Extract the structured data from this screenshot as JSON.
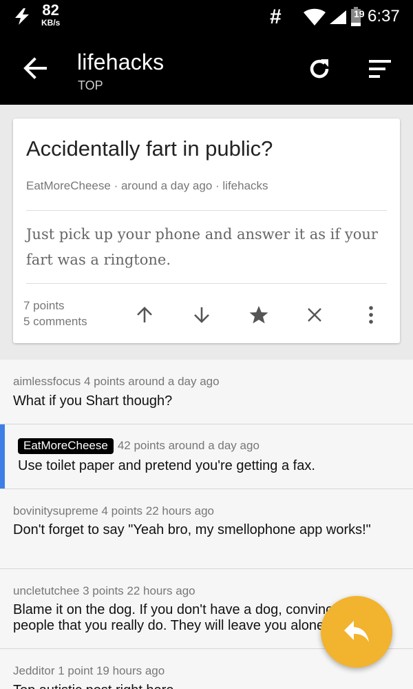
{
  "status_bar": {
    "speed_value": "82",
    "speed_unit": "KB/s",
    "hash": "#",
    "battery_level": "19",
    "time": "6:37"
  },
  "app_bar": {
    "title": "lifehacks",
    "subtitle": "TOP",
    "icons": [
      "back-arrow-icon",
      "refresh-icon",
      "sort-icon"
    ]
  },
  "post": {
    "title": "Accidentally fart in public?",
    "author": "EatMoreCheese",
    "time": "around a day ago",
    "subreddit": "lifehacks",
    "meta": "EatMoreCheese · around a day ago · lifehacks",
    "body": "Just pick up your phone and answer it as if your fart was a ringtone.",
    "points": "7 points",
    "comments": "5 comments",
    "actions": [
      "upvote-icon",
      "downvote-icon",
      "save-star-icon",
      "hide-close-icon",
      "more-vert-icon"
    ]
  },
  "comments": [
    {
      "author": "aimlessfocus",
      "meta": "aimlessfocus 4 points around a day ago",
      "text": "What if you Shart though?"
    },
    {
      "author": "EatMoreCheese",
      "meta": "42 points around a day ago",
      "text": "Use toilet paper and pretend you're getting a fax.",
      "is_op": true
    },
    {
      "author": "bovinitysupreme",
      "meta": "bovinitysupreme 4 points 22 hours ago",
      "text": "Don't forget to say \"Yeah bro, my smellophone app works!\""
    },
    {
      "author": "uncletutchee",
      "meta": "uncletutchee 3 points 22 hours ago",
      "text": "Blame it on the dog. If you don't have a dog, convince people that you really do. They will leave you alone."
    },
    {
      "author": "Jedditor",
      "meta": "Jedditor 1 point 19 hours ago",
      "text": "Top autistic post right here"
    }
  ],
  "colors": {
    "bar": "#000000",
    "op_accent": "#3d7fe6",
    "fab": "#f2b32e"
  },
  "fab": {
    "icon": "reply-icon"
  }
}
